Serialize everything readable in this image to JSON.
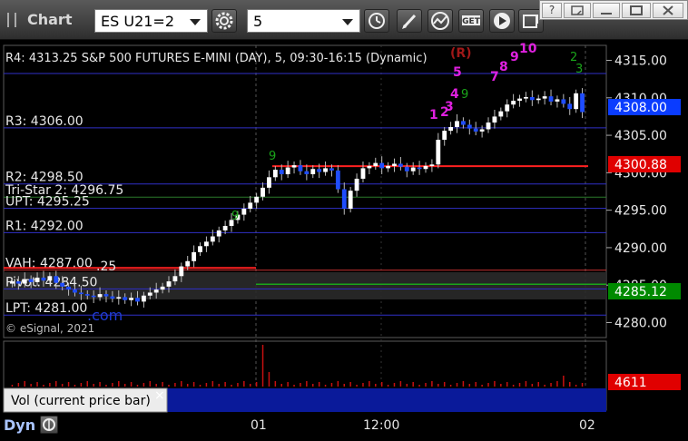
{
  "window": {
    "title": "Chart",
    "symbol": "ES U21=2",
    "interval": "5",
    "controls": {
      "help": "?",
      "restore": "restore-icon",
      "minimize": "minimize-icon",
      "maximize": "maximize-icon",
      "close": "close-icon"
    }
  },
  "chart": {
    "description": "R4: 4313.25 S&P 500 FUTURES E-MINI (DAY), 5, 09:30-16:15 (Dynamic)",
    "copyright": "© eSignal, 2021",
    "brand_watermark": ".com"
  },
  "levels": [
    {
      "label": "R4: 4313.25",
      "price": 4313.25,
      "color": "#3030c8"
    },
    {
      "label": "R3: 4306.00",
      "price": 4306.0,
      "color": "#3030c8"
    },
    {
      "label": "R2: 4298.50",
      "price": 4298.5,
      "color": "#3030c8"
    },
    {
      "label": "Tri-Star 2: 4296.75",
      "price": 4296.75,
      "color": "#2a7a2a"
    },
    {
      "label": "UPT: 4295.25",
      "price": 4295.25,
      "color": "#3030c8"
    },
    {
      "label": "R1: 4292.00",
      "price": 4292.0,
      "color": "#3030c8"
    },
    {
      "label": "VAH: 4287.00",
      "price": 4287.0,
      "color": "#c83030"
    },
    {
      "label": "Pivot: 4284.50",
      "price": 4284.5,
      "color": "#3030c8"
    },
    {
      "label": "LPT: 4281.00",
      "price": 4281.0,
      "color": "#3030c8"
    }
  ],
  "extra_label": ".25",
  "price_axis": {
    "ticks": [
      "4315.00",
      "4310.00",
      "4305.00",
      "4300.00",
      "4295.00",
      "4290.00",
      "4285.00",
      "4280.00"
    ],
    "current_price": "4308.00",
    "red_flag": "4300.88",
    "green_flag": "4285.12",
    "volume_flag": "4611",
    "colors": {
      "current": "#0a3cff",
      "red": "#e00000",
      "green": "#008a00"
    }
  },
  "volume_panel": {
    "label": "Vol (current price bar)",
    "collapse": "×"
  },
  "time_axis": {
    "labels": [
      "01",
      "12:00",
      "02"
    ]
  },
  "bottom": {
    "interval_mode": "Dyn"
  },
  "td_counts": {
    "green": [
      "9",
      "9",
      "9",
      "2",
      "3"
    ],
    "magenta": [
      "1",
      "2",
      "3",
      "4",
      "5",
      "7",
      "8",
      "9",
      "10"
    ],
    "setup_flag": "(R)"
  },
  "chart_data": {
    "type": "candlestick",
    "title": "R4: 4313.25 S&P 500 FUTURES E-MINI (DAY), 5, 09:30-16:15 (Dynamic)",
    "ylim": [
      4278,
      4317
    ],
    "yticks": [
      4280,
      4285,
      4290,
      4295,
      4300,
      4305,
      4310,
      4315
    ],
    "xticks": [
      "01",
      "12:00",
      "02"
    ],
    "closes": [
      4285.5,
      4285.2,
      4285.8,
      4285.4,
      4286.0,
      4285.6,
      4286.2,
      4285.3,
      4284.8,
      4284.4,
      4284.0,
      4283.8,
      4283.6,
      4283.4,
      4283.8,
      4283.5,
      4283.2,
      4283.4,
      4283.0,
      4283.3,
      4282.8,
      4283.6,
      4284.0,
      4284.4,
      4284.8,
      4285.5,
      4286.2,
      4287.5,
      4288.2,
      4289.4,
      4290.2,
      4290.8,
      4291.5,
      4292.3,
      4292.9,
      4293.7,
      4294.4,
      4295.2,
      4296.0,
      4296.8,
      4298.0,
      4299.4,
      4300.4,
      4299.8,
      4300.7,
      4301.0,
      4300.2,
      4299.8,
      4300.5,
      4300.1,
      4300.6,
      4300.3,
      4297.8,
      4295.2,
      4297.6,
      4299.2,
      4300.6,
      4300.9,
      4301.3,
      4300.6,
      4300.9,
      4301.2,
      4300.8,
      4300.2,
      4300.7,
      4300.5,
      4300.9,
      4301.1,
      4304.4,
      4305.6,
      4306.1,
      4306.9,
      4306.4,
      4305.9,
      4305.5,
      4305.8,
      4306.7,
      4307.5,
      4308.2,
      4309.1,
      4309.6,
      4309.9,
      4310.1,
      4309.7,
      4309.9,
      4310.2,
      4309.5,
      4309.8,
      4309.2,
      4308.5,
      4310.6,
      4308.1
    ],
    "volume_max": 4611
  }
}
